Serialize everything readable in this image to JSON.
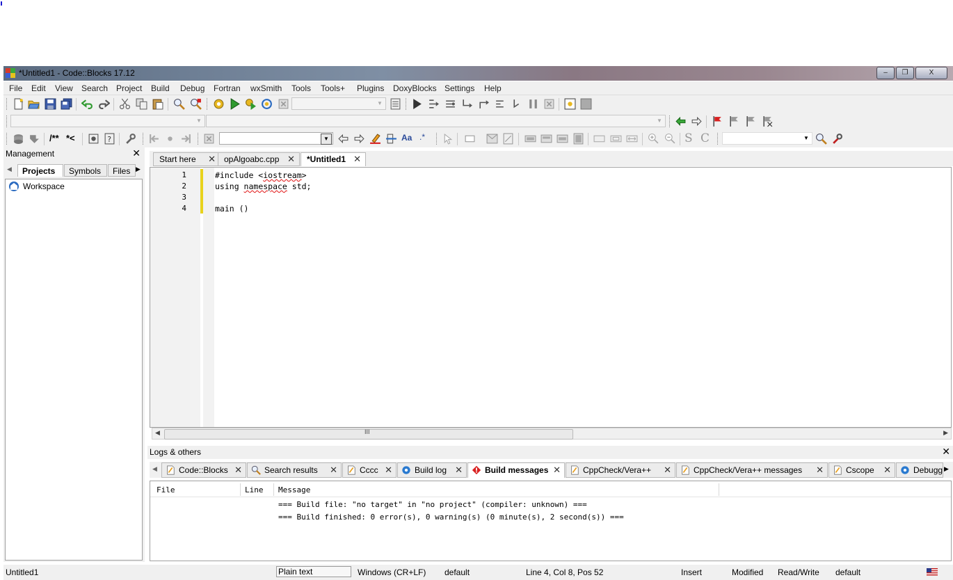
{
  "window": {
    "title": "*Untitled1 - Code::Blocks 17.12",
    "minimize_glyph": "–",
    "restore_glyph": "❐",
    "close_glyph": "X"
  },
  "menu": [
    "File",
    "Edit",
    "View",
    "Search",
    "Project",
    "Build",
    "Debug",
    "Fortran",
    "wxSmith",
    "Tools",
    "Tools+",
    "Plugins",
    "DoxyBlocks",
    "Settings",
    "Help"
  ],
  "toolbar": {
    "doxy_comment_label": "/**",
    "doxy_line_label": "*<",
    "text_s": "S",
    "text_c": "C"
  },
  "management": {
    "title": "Management",
    "close_glyph": "✕",
    "tabs": [
      "Projects",
      "Symbols",
      "Files"
    ],
    "active_tab": "Projects",
    "tree_root": "Workspace"
  },
  "editor": {
    "tabs": [
      {
        "label": "Start here",
        "active": false
      },
      {
        "label": "opAlgoabc.cpp",
        "active": false
      },
      {
        "label": "*Untitled1",
        "active": true
      }
    ],
    "line_numbers": [
      "1",
      "2",
      "3",
      "4"
    ],
    "lines": [
      "#include <iostream>",
      "using namespace std;",
      "",
      "main ()"
    ],
    "scroll_grip": "III"
  },
  "logs": {
    "title": "Logs & others",
    "close_glyph": "✕",
    "tabs": [
      {
        "label": "Code::Blocks",
        "icon": "page-icon",
        "active": false
      },
      {
        "label": "Search results",
        "icon": "magnifier-icon",
        "active": false
      },
      {
        "label": "Cccc",
        "icon": "page-icon",
        "active": false
      },
      {
        "label": "Build log",
        "icon": "gear-icon",
        "active": false
      },
      {
        "label": "Build messages",
        "icon": "error-icon",
        "active": true
      },
      {
        "label": "CppCheck/Vera++",
        "icon": "page-icon",
        "active": false
      },
      {
        "label": "CppCheck/Vera++ messages",
        "icon": "page-icon",
        "active": false
      },
      {
        "label": "Cscope",
        "icon": "page-icon",
        "active": false
      },
      {
        "label": "Debugge",
        "icon": "gear-icon",
        "active": false
      }
    ],
    "columns": [
      "File",
      "Line",
      "Message"
    ],
    "messages": [
      "=== Build file: \"no target\" in \"no project\" (compiler: unknown) ===",
      "=== Build finished: 0 error(s), 0 warning(s) (0 minute(s), 2 second(s)) ==="
    ]
  },
  "status": {
    "file": "Untitled1",
    "lexer": "Plain text",
    "eol": "Windows (CR+LF)",
    "encoding": "default",
    "position": "Line 4, Col 8, Pos 52",
    "mode": "Insert",
    "modified": "Modified",
    "access": "Read/Write",
    "profile": "default"
  },
  "colors": {
    "editor_change_bar": "#e8d21c",
    "accent_green": "#2f9a2f",
    "accent_red": "#d92020",
    "squiggle": "#e01010"
  }
}
